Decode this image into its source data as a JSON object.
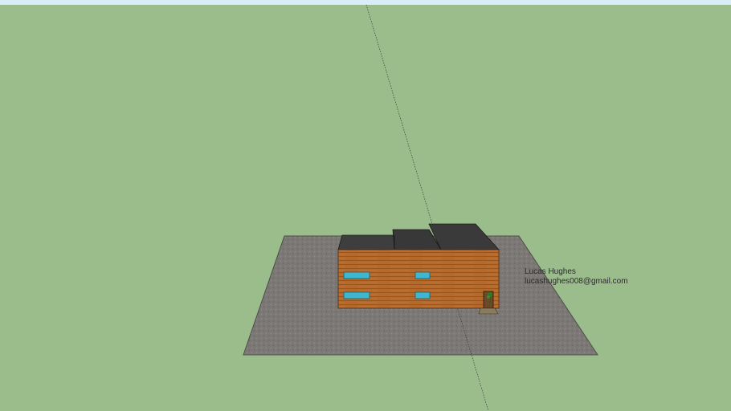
{
  "scene": {
    "colors": {
      "ground": "#9bbd8c",
      "sky": "#d9ecf8",
      "pavement": "#7b7875",
      "wall": "#b5692b",
      "roof": "#3e3e3e",
      "window": "#3fb7cf",
      "door": "#6a4a28"
    }
  },
  "author": {
    "name": "Lucas Hughes",
    "email": "lucashughes008@gmail.com"
  }
}
